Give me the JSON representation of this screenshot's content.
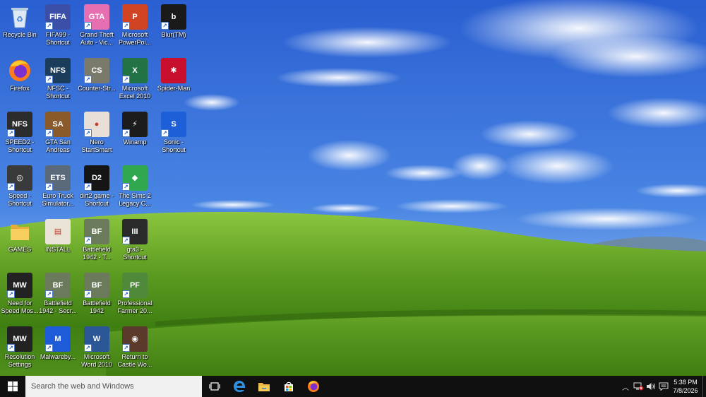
{
  "desktop": {
    "icons": [
      {
        "label": "Recycle Bin",
        "icon": "recycle-bin-icon",
        "glyph": "♻",
        "color": "#9bb8d8",
        "shortcut": false
      },
      {
        "label": "FIFA99 - Shortcut",
        "icon": "fifa99-icon",
        "glyph": "FIFA",
        "color": "#3b4fa8",
        "shortcut": true
      },
      {
        "label": "Grand Theft Auto - Vic...",
        "icon": "gta-vice-city-icon",
        "glyph": "GTA",
        "color": "#e66fb1",
        "shortcut": true
      },
      {
        "label": "Microsoft PowerPoi...",
        "icon": "powerpoint-icon",
        "glyph": "P",
        "color": "#d04423",
        "shortcut": true
      },
      {
        "label": "Blur(TM)",
        "icon": "blur-icon",
        "glyph": "b",
        "color": "#1a1a1a",
        "shortcut": true
      },
      {
        "label": "Firefox",
        "icon": "firefox-icon",
        "glyph": "",
        "color": "#ff7139",
        "shortcut": false
      },
      {
        "label": "NFSC - Shortcut",
        "icon": "nfsc-icon",
        "glyph": "NFS",
        "color": "#1b3c5a",
        "shortcut": true
      },
      {
        "label": "Counter-Str...",
        "icon": "counter-strike-icon",
        "glyph": "CS",
        "color": "#7a7a6a",
        "shortcut": true
      },
      {
        "label": "Microsoft Excel 2010",
        "icon": "excel-icon",
        "glyph": "X",
        "color": "#217346",
        "shortcut": true
      },
      {
        "label": "Spider-Man",
        "icon": "spider-man-icon",
        "glyph": "✱",
        "color": "#c8102e",
        "shortcut": false
      },
      {
        "label": "SPEED2 - Shortcut",
        "icon": "speed2-icon",
        "glyph": "NFS",
        "color": "#2c2c2c",
        "shortcut": true
      },
      {
        "label": "GTA San Andreas",
        "icon": "gta-san-andreas-icon",
        "glyph": "SA",
        "color": "#8a5a2b",
        "shortcut": true
      },
      {
        "label": "Nero StartSmart",
        "icon": "nero-icon",
        "glyph": "●",
        "color": "#e8e0d8",
        "shortcut": true
      },
      {
        "label": "Winamp",
        "icon": "winamp-icon",
        "glyph": "⚡",
        "color": "#1c1c1c",
        "shortcut": true
      },
      {
        "label": "Sonic - Shortcut",
        "icon": "sonic-icon",
        "glyph": "S",
        "color": "#1d5fd6",
        "shortcut": true
      },
      {
        "label": "Speed - Shortcut",
        "icon": "speed-icon",
        "glyph": "◎",
        "color": "#3a3a3a",
        "shortcut": true
      },
      {
        "label": "Euro Truck Simulator...",
        "icon": "euro-truck-icon",
        "glyph": "ETS",
        "color": "#5a6a7a",
        "shortcut": true
      },
      {
        "label": "dirt2 game - Shortcut",
        "icon": "dirt2-icon",
        "glyph": "D2",
        "color": "#151515",
        "shortcut": true
      },
      {
        "label": "The Sims 2 Legacy C...",
        "icon": "sims2-icon",
        "glyph": "◆",
        "color": "#2fa84f",
        "shortcut": true
      },
      {
        "label": "GAMES",
        "icon": "folder-icon",
        "glyph": "",
        "color": "#e8b94a",
        "shortcut": false
      },
      {
        "label": "INSTALL",
        "icon": "install-icon",
        "glyph": "▤",
        "color": "#e9e4d6",
        "shortcut": false
      },
      {
        "label": "Battlefield 1942 - T...",
        "icon": "battlefield-1942-icon",
        "glyph": "BF",
        "color": "#6b7a5a",
        "shortcut": true
      },
      {
        "label": "gta3 - Shortcut",
        "icon": "gta3-icon",
        "glyph": "III",
        "color": "#2a2a2a",
        "shortcut": true
      },
      {
        "label": "Need for Speed Mos...",
        "icon": "nfs-most-wanted-icon",
        "glyph": "MW",
        "color": "#222222",
        "shortcut": true
      },
      {
        "label": "Battlefield 1942 - Secr...",
        "icon": "battlefield-1942-secret-icon",
        "glyph": "BF",
        "color": "#6b7a5a",
        "shortcut": true
      },
      {
        "label": "Battlefield 1942",
        "icon": "battlefield-1942-main-icon",
        "glyph": "BF",
        "color": "#6b7a5a",
        "shortcut": true
      },
      {
        "label": "Professional Farmer 20...",
        "icon": "professional-farmer-icon",
        "glyph": "PF",
        "color": "#4f8a3a",
        "shortcut": true
      },
      {
        "label": "Resolution Settings",
        "icon": "resolution-settings-icon",
        "glyph": "MW",
        "color": "#222222",
        "shortcut": true
      },
      {
        "label": "Malwareby...",
        "icon": "malwarebytes-icon",
        "glyph": "M",
        "color": "#1e5bd9",
        "shortcut": true
      },
      {
        "label": "Microsoft Word 2010",
        "icon": "word-icon",
        "glyph": "W",
        "color": "#2b5797",
        "shortcut": true
      },
      {
        "label": "Return to Castle Wo...",
        "icon": "rtcw-icon",
        "glyph": "◉",
        "color": "#5a3a2a",
        "shortcut": true
      }
    ]
  },
  "taskbar": {
    "search_placeholder": "Search the web and Windows",
    "pinned": [
      {
        "icon": "task-view-icon"
      },
      {
        "icon": "edge-icon"
      },
      {
        "icon": "file-explorer-icon"
      },
      {
        "icon": "store-icon"
      },
      {
        "icon": "firefox-icon"
      }
    ],
    "tray": {
      "time": "5:38 PM",
      "date": "7/8/2026"
    }
  },
  "colors": {
    "taskbar_bg": "#101010",
    "sky_top": "#2a64d6",
    "sky_bottom": "#a9c8ee",
    "hill_green": "#5c9e22"
  }
}
